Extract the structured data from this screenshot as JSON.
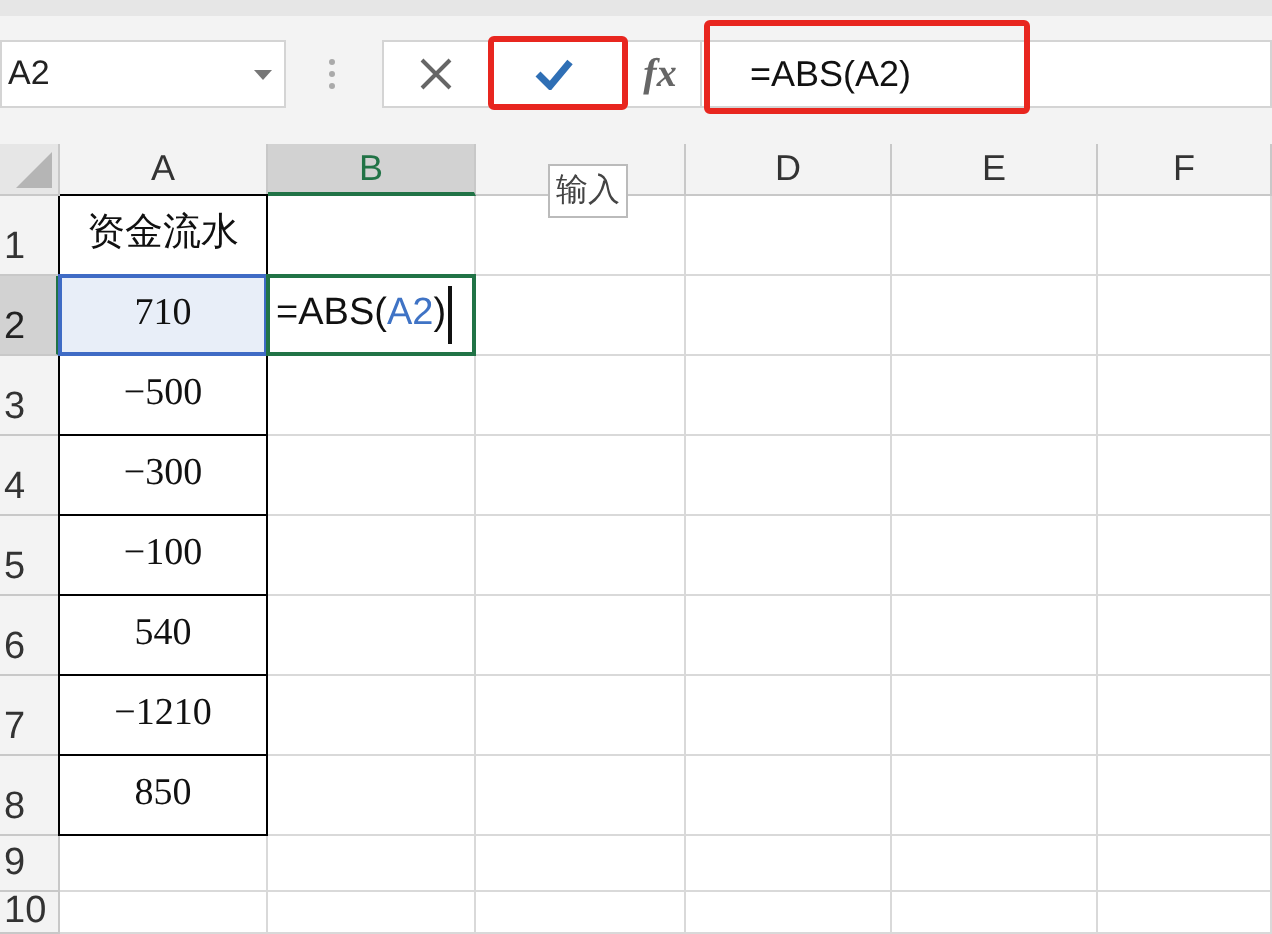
{
  "name_box": {
    "value": "A2"
  },
  "formula_bar": {
    "fx_label": "fx",
    "value": "=ABS(A2)"
  },
  "tooltip": {
    "text": "输入"
  },
  "columns": [
    {
      "label": "A",
      "selected": false
    },
    {
      "label": "B",
      "selected": true
    },
    {
      "selected": false
    },
    {
      "label": "D",
      "selected": false
    },
    {
      "label": "E",
      "selected": false
    },
    {
      "label": "F",
      "selected": false
    }
  ],
  "rows": [
    {
      "label": "1",
      "selected": false,
      "cells": [
        {
          "text": "资金流水",
          "kind": "header"
        }
      ]
    },
    {
      "label": "2",
      "selected": true,
      "cells": [
        {
          "text": "710",
          "kind": "selected"
        },
        {
          "kind": "editing",
          "segments": [
            {
              "text": "=ABS(",
              "kind": "plain"
            },
            {
              "text": "A2",
              "kind": "reference"
            },
            {
              "text": ")",
              "kind": "plain"
            }
          ]
        }
      ]
    },
    {
      "label": "3",
      "selected": false,
      "cells": [
        {
          "text": "−500",
          "kind": "number"
        }
      ]
    },
    {
      "label": "4",
      "selected": false,
      "cells": [
        {
          "text": "−300",
          "kind": "number"
        }
      ]
    },
    {
      "label": "5",
      "selected": false,
      "cells": [
        {
          "text": "−100",
          "kind": "number"
        }
      ]
    },
    {
      "label": "6",
      "selected": false,
      "cells": [
        {
          "text": "540",
          "kind": "number"
        }
      ]
    },
    {
      "label": "7",
      "selected": false,
      "cells": [
        {
          "text": "−1210",
          "kind": "number"
        }
      ]
    },
    {
      "label": "8",
      "selected": false,
      "cells": [
        {
          "text": "850",
          "kind": "number"
        }
      ]
    },
    {
      "label": "9",
      "selected": false,
      "cells": []
    },
    {
      "label": "10",
      "selected": false,
      "cells": []
    }
  ]
}
